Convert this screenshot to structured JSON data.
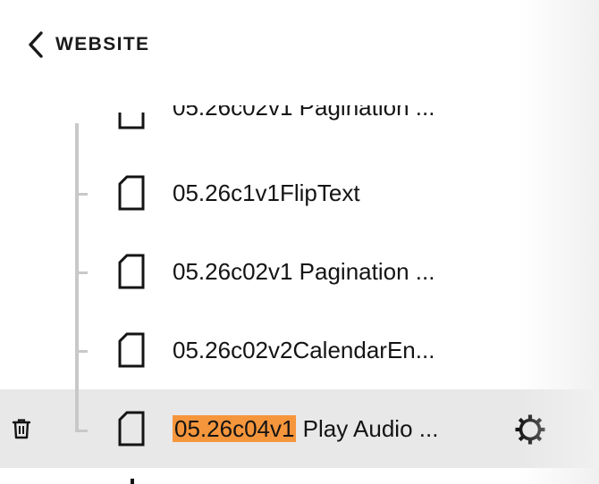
{
  "header": {
    "back_icon": "chevron-left-icon",
    "title": "WEBSITE"
  },
  "tree": {
    "partial_item_above": "05.26c02v1 Pagination ...",
    "items": [
      {
        "label": "05.26c1v1FlipText",
        "icon": "page-icon"
      },
      {
        "label": "05.26c02v1 Pagination ...",
        "icon": "page-icon"
      },
      {
        "label": "05.26c02v2CalendarEn...",
        "icon": "page-icon"
      },
      {
        "label_highlight": "05.26c04v1",
        "label_rest": " Play Audio ...",
        "icon": "page-icon",
        "selected": true,
        "actions": [
          "trash-icon",
          "gear-icon"
        ]
      }
    ]
  },
  "colors": {
    "search_highlight": "#f6963c",
    "selected_row_bg": "#e8e8e8",
    "tree_line": "#c8c8c8",
    "text": "#141414"
  }
}
